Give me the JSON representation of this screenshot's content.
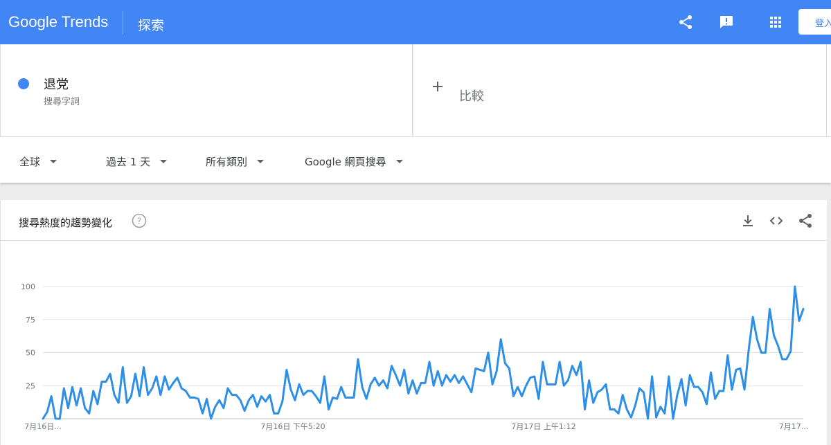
{
  "header": {
    "logo_text": "Google Trends",
    "section_title": "探索",
    "signin_label": "登入",
    "icons": [
      "share-icon",
      "feedback-icon",
      "apps-icon"
    ],
    "brand_color": "#4285f4"
  },
  "term": {
    "name": "退党",
    "type": "搜尋字詞",
    "color": "#4285f4"
  },
  "compare": {
    "label": "比較"
  },
  "filters": {
    "region": "全球",
    "time": "過去 1 天",
    "category": "所有類別",
    "property": "Google 網頁搜尋"
  },
  "chart_card": {
    "title": "搜尋熱度的趨勢變化",
    "icons": [
      "help-icon",
      "download-icon",
      "embed-icon",
      "share-icon"
    ]
  },
  "chart_data": {
    "type": "line",
    "ylim": [
      0,
      100
    ],
    "y_ticks": [
      25,
      50,
      75,
      100
    ],
    "x_tick_labels": [
      "7月16日...",
      "7月16日 下午5:20",
      "7月17日 上午1:12",
      "7月17..."
    ],
    "grid": true,
    "series": [
      {
        "color": "#2d8fe6",
        "values": [
          0,
          5,
          17,
          0,
          0,
          23,
          8,
          24,
          10,
          23,
          8,
          4,
          21,
          11,
          28,
          28,
          34,
          18,
          12,
          39,
          12,
          17,
          34,
          17,
          39,
          18,
          23,
          32,
          18,
          32,
          22,
          27,
          31,
          23,
          21,
          16,
          16,
          15,
          4,
          15,
          0,
          9,
          14,
          8,
          23,
          18,
          18,
          14,
          6,
          14,
          18,
          9,
          17,
          13,
          18,
          4,
          4,
          13,
          37,
          22,
          14,
          26,
          18,
          21,
          21,
          17,
          12,
          32,
          7,
          16,
          15,
          24,
          16,
          16,
          16,
          45,
          24,
          15,
          26,
          31,
          25,
          29,
          23,
          40,
          33,
          25,
          37,
          19,
          29,
          19,
          27,
          27,
          43,
          25,
          36,
          25,
          33,
          28,
          33,
          27,
          32,
          26,
          20,
          38,
          37,
          36,
          50,
          26,
          36,
          60,
          42,
          38,
          17,
          24,
          17,
          25,
          31,
          32,
          15,
          43,
          26,
          26,
          26,
          43,
          25,
          29,
          40,
          33,
          43,
          7,
          29,
          12,
          20,
          22,
          26,
          7,
          7,
          4,
          18,
          7,
          1,
          10,
          23,
          20,
          0,
          32,
          1,
          9,
          4,
          32,
          0,
          18,
          30,
          10,
          33,
          24,
          24,
          20,
          11,
          35,
          15,
          21,
          21,
          48,
          22,
          37,
          38,
          22,
          52,
          77,
          60,
          50,
          50,
          83,
          63,
          55,
          45,
          45,
          51,
          100,
          74,
          83
        ]
      }
    ]
  }
}
